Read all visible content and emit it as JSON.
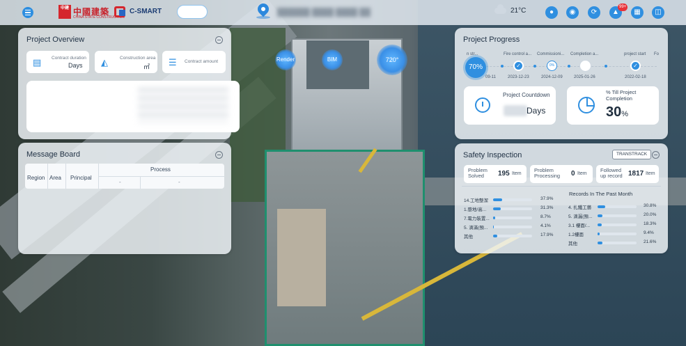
{
  "header": {
    "logo_badge": "中建",
    "logo_text": "中國建築",
    "logo_sub": "CHINA STATE CONSTRUCTION",
    "brand": "C-SMART",
    "weather_temp": "21°C",
    "notification_count": "99+"
  },
  "overview": {
    "title": "Project Overview",
    "duration_label": "Contract duration",
    "duration_value": "Days",
    "area_label": "Construction area",
    "area_value": "㎡",
    "amount_label": "Contract amount"
  },
  "message_board": {
    "title": "Message Board",
    "columns": [
      "Region",
      "Area",
      "Principal"
    ],
    "process_label": "Process",
    "placeholder": "-"
  },
  "tags": [
    "Render",
    "BIM",
    "720°"
  ],
  "progress": {
    "title": "Project Progress",
    "overall_pct": "70%",
    "milestones": [
      {
        "label": "n str...",
        "date": "09-11"
      },
      {
        "label": "Fire control a...",
        "date": "2023-12-23"
      },
      {
        "label": "Commissioni...",
        "date": "2024-12-09",
        "pct": "0%"
      },
      {
        "label": "Completion a...",
        "date": "2025-01-26"
      },
      {
        "label": "project start",
        "date": "2022-02-18"
      },
      {
        "label": "Fo",
        "date": ""
      }
    ],
    "countdown_label": "Project Countdown",
    "countdown_unit": "Days",
    "till_label": "% Till Project Completion",
    "till_value": "30",
    "till_unit": "%"
  },
  "safety": {
    "title": "Safety Inspection",
    "button": "TRANSTRACK",
    "stats": [
      {
        "label": "Problem Solved",
        "value": "195",
        "unit": "Item"
      },
      {
        "label": "Problem Processing",
        "value": "0",
        "unit": "Item"
      },
      {
        "label": "Followed up record",
        "value": "1817",
        "unit": "Item"
      }
    ],
    "past_month_label": "Records In The Past Month",
    "left_rows": [
      {
        "name": "14.工地整潔",
        "pct": "37.9%",
        "fraction": 0.379
      },
      {
        "name": "1.墮地/高...",
        "pct": "31.3%",
        "fraction": 0.313
      },
      {
        "name": "7.電力裝置...",
        "pct": "8.7%",
        "fraction": 0.087
      },
      {
        "name": "5. 滴滿(預...",
        "pct": "4.1%",
        "fraction": 0.041
      },
      {
        "name": "其他",
        "pct": "17.9%",
        "fraction": 0.179
      }
    ],
    "right_rows": [
      {
        "name": "4. 扎鐵工藝",
        "pct": "30.8%",
        "fraction": 0.308
      },
      {
        "name": "5. 滴漏(預...",
        "pct": "20.0%",
        "fraction": 0.2
      },
      {
        "name": "3.1 樓面/...",
        "pct": "18.3%",
        "fraction": 0.183
      },
      {
        "name": "1.2樓面",
        "pct": "9.4%",
        "fraction": 0.094
      },
      {
        "name": "其他",
        "pct": "21.6%",
        "fraction": 0.216
      }
    ]
  }
}
